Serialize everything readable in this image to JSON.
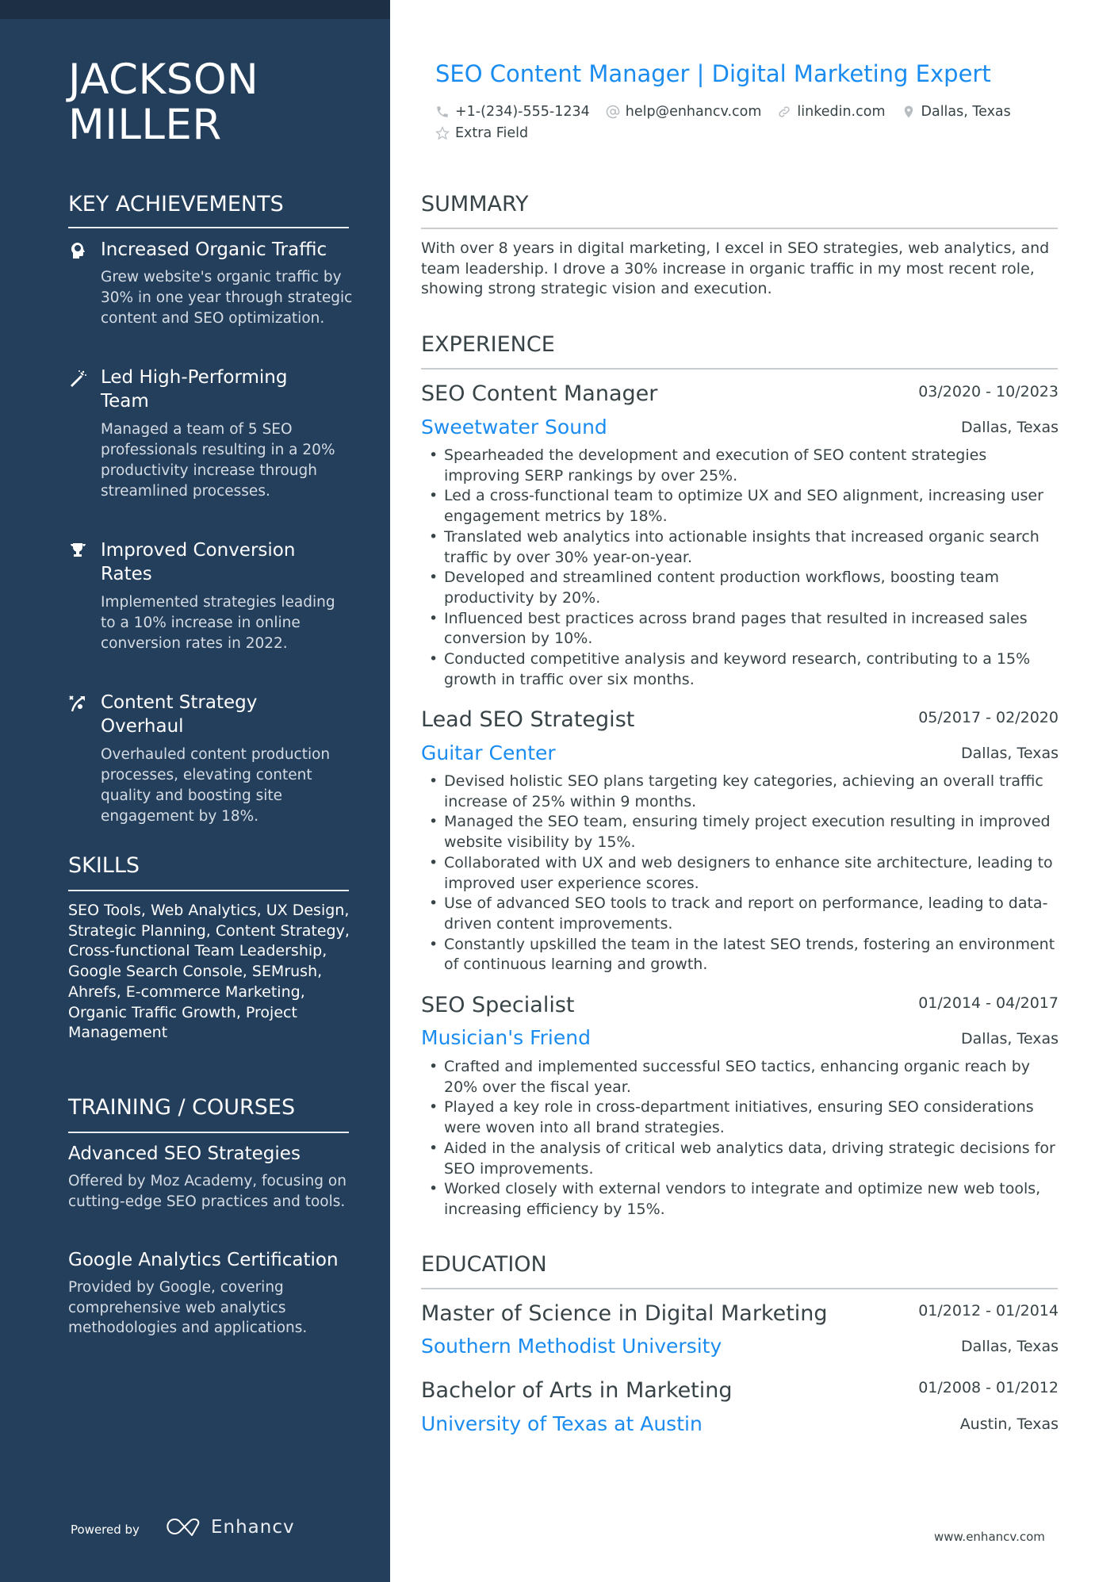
{
  "sidebar": {
    "name_line1": "JACKSON",
    "name_line2": "MILLER",
    "achievements_heading": "KEY ACHIEVEMENTS",
    "achievements": [
      {
        "icon": "head-brain-icon",
        "title_lines": [
          "Increased Organic Traffic"
        ],
        "desc": "Grew website's organic traffic by 30% in one year through strategic content and SEO optimization."
      },
      {
        "icon": "magic-wand-icon",
        "title_lines": [
          "Led High-Performing",
          "Team"
        ],
        "desc": "Managed a team of 5 SEO professionals resulting in a 20% productivity increase through streamlined processes."
      },
      {
        "icon": "trophy-icon",
        "title_lines": [
          "Improved Conversion",
          "Rates"
        ],
        "desc": "Implemented strategies leading to a 10% increase in online conversion rates in 2022."
      },
      {
        "icon": "strategy-play-icon",
        "title_lines": [
          "Content Strategy",
          "Overhaul"
        ],
        "desc": "Overhauled content production processes, elevating content quality and boosting site engagement by 18%."
      }
    ],
    "skills_heading": "SKILLS",
    "skills_text": "SEO Tools, Web Analytics, UX Design, Strategic Planning, Content Strategy, Cross-functional Team Leadership, Google Search Console, SEMrush, Ahrefs, E-commerce Marketing, Organic Traffic Growth, Project Management",
    "training_heading": "TRAINING / COURSES",
    "courses": [
      {
        "title": "Advanced SEO Strategies",
        "desc": "Offered by Moz Academy, focusing on cutting-edge SEO practices and tools."
      },
      {
        "title": "Google Analytics Certification",
        "desc": "Provided by Google, covering comprehensive web analytics methodologies and applications."
      }
    ],
    "powered_by": "Powered by",
    "brand": "Enhancv"
  },
  "header": {
    "headline": "SEO Content Manager | Digital Marketing Expert",
    "contacts": [
      {
        "icon": "phone-icon",
        "text": "+1-(234)-555-1234"
      },
      {
        "icon": "at-icon",
        "text": "help@enhancv.com"
      },
      {
        "icon": "link-icon",
        "text": "linkedin.com"
      },
      {
        "icon": "location-pin-icon",
        "text": "Dallas, Texas"
      }
    ],
    "extra": {
      "icon": "star-icon",
      "text": "Extra Field"
    }
  },
  "summary": {
    "heading": "SUMMARY",
    "text": "With over 8 years in digital marketing, I excel in SEO strategies, web analytics, and team leadership. I drove a 30% increase in organic traffic in my most recent role, showing strong strategic vision and execution."
  },
  "experience": {
    "heading": "EXPERIENCE",
    "jobs": [
      {
        "role": "SEO Content Manager",
        "dates": "03/2020 - 10/2023",
        "company": "Sweetwater Sound",
        "location": "Dallas, Texas",
        "bullets": [
          "Spearheaded the development and execution of SEO content strategies improving SERP rankings by over 25%.",
          "Led a cross-functional team to optimize UX and SEO alignment, increasing user engagement metrics by 18%.",
          "Translated web analytics into actionable insights that increased organic search traffic by over 30% year-on-year.",
          "Developed and streamlined content production workflows, boosting team productivity by 20%.",
          "Influenced best practices across brand pages that resulted in increased sales conversion by 10%.",
          "Conducted competitive analysis and keyword research, contributing to a 15% growth in traffic over six months."
        ]
      },
      {
        "role": "Lead SEO Strategist",
        "dates": "05/2017 - 02/2020",
        "company": "Guitar Center",
        "location": "Dallas, Texas",
        "bullets": [
          "Devised holistic SEO plans targeting key categories, achieving an overall traffic increase of 25% within 9 months.",
          "Managed the SEO team, ensuring timely project execution resulting in improved website visibility by 15%.",
          "Collaborated with UX and web designers to enhance site architecture, leading to improved user experience scores.",
          "Use of advanced SEO tools to track and report on performance, leading to data-driven content improvements.",
          "Constantly upskilled the team in the latest SEO trends, fostering an environment of continuous learning and growth."
        ]
      },
      {
        "role": "SEO Specialist",
        "dates": "01/2014 - 04/2017",
        "company": "Musician's Friend",
        "location": "Dallas, Texas",
        "bullets": [
          "Crafted and implemented successful SEO tactics, enhancing organic reach by 20% over the fiscal year.",
          "Played a key role in cross-department initiatives, ensuring SEO considerations were woven into all brand strategies.",
          "Aided in the analysis of critical web analytics data, driving strategic decisions for SEO improvements.",
          "Worked closely with external vendors to integrate and optimize new web tools, increasing efficiency by 15%."
        ]
      }
    ]
  },
  "education": {
    "heading": "EDUCATION",
    "items": [
      {
        "degree": "Master of Science in Digital Marketing",
        "dates": "01/2012 - 01/2014",
        "school": "Southern Methodist University",
        "location": "Dallas, Texas"
      },
      {
        "degree": "Bachelor of Arts in Marketing",
        "dates": "01/2008 - 01/2012",
        "school": "University of Texas at Austin",
        "location": "Austin, Texas"
      }
    ]
  },
  "footer": {
    "url": "www.enhancv.com"
  },
  "colors": {
    "sidebar": "#243f5c",
    "topstrip": "#1c2f45",
    "accent": "#1a8cf0",
    "text": "#384347"
  }
}
